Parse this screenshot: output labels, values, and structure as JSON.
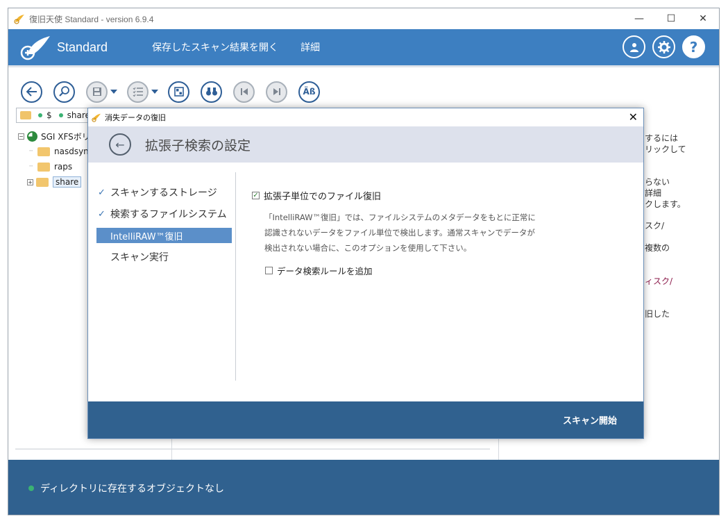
{
  "window": {
    "title": "復旧天使 Standard - version 6.9.4",
    "controls": {
      "minimize": "—",
      "maximize": "☐",
      "close": "✕"
    }
  },
  "header": {
    "brand": "Standard",
    "menu": [
      "保存したスキャン結果を開く",
      "詳細"
    ],
    "icons": [
      "user-icon",
      "gear-icon",
      "help-icon"
    ],
    "help_glyph": "?",
    "accent": "#3d7fc1"
  },
  "toolbar": {
    "buttons": [
      "back-icon",
      "search-icon",
      "save-icon",
      "list-icon",
      "grid-icon",
      "binoculars-icon",
      "prev-icon",
      "next-icon",
      "case-icon"
    ],
    "case_label": "Äß"
  },
  "pathbar": {
    "root": "$",
    "folder": "share"
  },
  "tree": {
    "root": "SGI XFSボリ",
    "items": [
      "nasdsyn",
      "raps",
      "share"
    ]
  },
  "right_pane": {
    "lines": [
      "するには",
      "リックして",
      "らない",
      "詳細",
      "クします。",
      "スク/",
      "複数の",
      "ィスク/",
      "旧した"
    ]
  },
  "status": {
    "text": "ディレクトリに存在するオブジェクトなし",
    "color": "#30618f"
  },
  "dialog": {
    "title": "消失データの復旧",
    "heading": "拡張子検索の設定",
    "steps": [
      {
        "label": "スキャンするストレージ",
        "done": true
      },
      {
        "label": "検索するファイルシステム",
        "done": true
      },
      {
        "label": "IntelliRAW™復旧",
        "active": true
      },
      {
        "label": "スキャン実行"
      }
    ],
    "option_main": {
      "label": "拡張子単位でのファイル復旧",
      "checked": true
    },
    "description": [
      "「IntelliRAW™復旧」では、ファイルシステムのメタデータをもとに正常に",
      "認識されないデータをファイル単位で検出します。通常スキャンでデータが",
      "検出されない場合に、このオプションを使用して下さい。"
    ],
    "option_rule": {
      "label": "データ検索ルールを追加",
      "checked": false
    },
    "start_button": "スキャン開始",
    "check_glyph": "✓",
    "close_glyph": "✕",
    "back_glyph": "←"
  }
}
